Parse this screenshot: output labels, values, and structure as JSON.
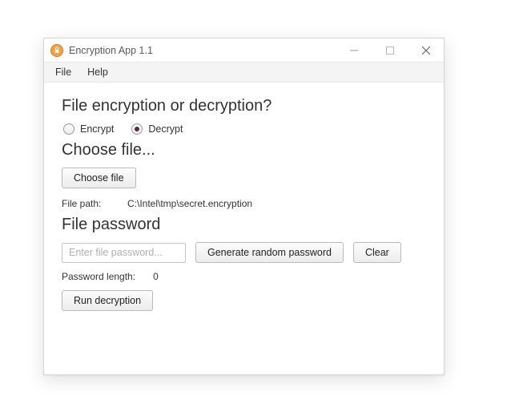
{
  "window": {
    "title": "Encryption App 1.1"
  },
  "menubar": {
    "file": "File",
    "help": "Help"
  },
  "sections": {
    "mode_title": "File encryption or decryption?",
    "choose_title": "Choose file...",
    "password_title": "File password"
  },
  "mode": {
    "encrypt_label": "Encrypt",
    "decrypt_label": "Decrypt",
    "selected": "decrypt"
  },
  "choose": {
    "button_label": "Choose file",
    "path_label": "File path:",
    "path_value": "C:\\Intel\\tmp\\secret.encryption"
  },
  "password": {
    "placeholder": "Enter file password...",
    "value": "",
    "generate_label": "Generate random password",
    "clear_label": "Clear",
    "length_label": "Password length:",
    "length_value": "0"
  },
  "run": {
    "button_label": "Run decryption"
  }
}
